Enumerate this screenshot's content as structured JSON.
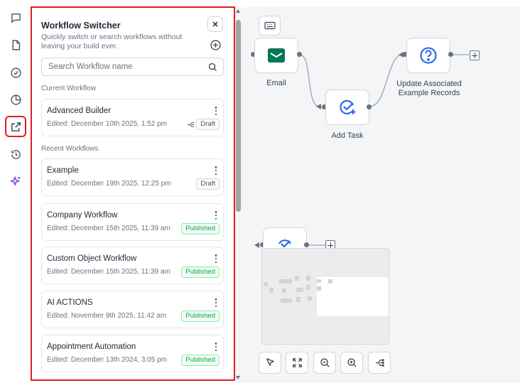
{
  "rail": {
    "items": [
      {
        "name": "chat-icon"
      },
      {
        "name": "document-icon"
      },
      {
        "name": "check-circle-icon"
      },
      {
        "name": "pie-chart-icon"
      },
      {
        "name": "external-link-icon",
        "active": true
      },
      {
        "name": "history-icon"
      },
      {
        "name": "sparkles-icon"
      }
    ]
  },
  "panel": {
    "title": "Workflow Switcher",
    "subtitle": "Quickly switch or search workflows without leaving your build ever.",
    "search_placeholder": "Search Workflow name",
    "current_label": "Current Workflow",
    "recent_label": "Recent Workflows",
    "current": {
      "name": "Advanced Builder",
      "edited": "Edited: December 10th 2025, 1:52 pm",
      "badge": "Draft",
      "badge_type": "draft"
    },
    "recent": [
      {
        "name": "Example",
        "edited": "Edited: December 19th 2025, 12:25 pm",
        "badge": "Draft",
        "badge_type": "draft"
      },
      {
        "name": "Company Workflow",
        "edited": "Edited: December 15th 2025, 11:39 am",
        "badge": "Published",
        "badge_type": "published"
      },
      {
        "name": "Custom Object Workflow",
        "edited": "Edited: December 15th 2025, 11:39 am",
        "badge": "Published",
        "badge_type": "published"
      },
      {
        "name": "AI ACTIONS",
        "edited": "Edited: November 9th 2025, 11:42 am",
        "badge": "Published",
        "badge_type": "published"
      },
      {
        "name": "Appointment Automation",
        "edited": "Edited: December 13th 2024, 3:05 pm",
        "badge": "Published",
        "badge_type": "published"
      }
    ]
  },
  "canvas": {
    "nodes": {
      "email": "Email",
      "add_task": "Add Task",
      "update_line1": "Update Associated",
      "update_line2": "Example Records"
    }
  },
  "colors": {
    "highlight": "#e11d22",
    "email_icon": "#047857",
    "action_icon": "#2563eb",
    "ai_icon": "#7c3aed"
  }
}
